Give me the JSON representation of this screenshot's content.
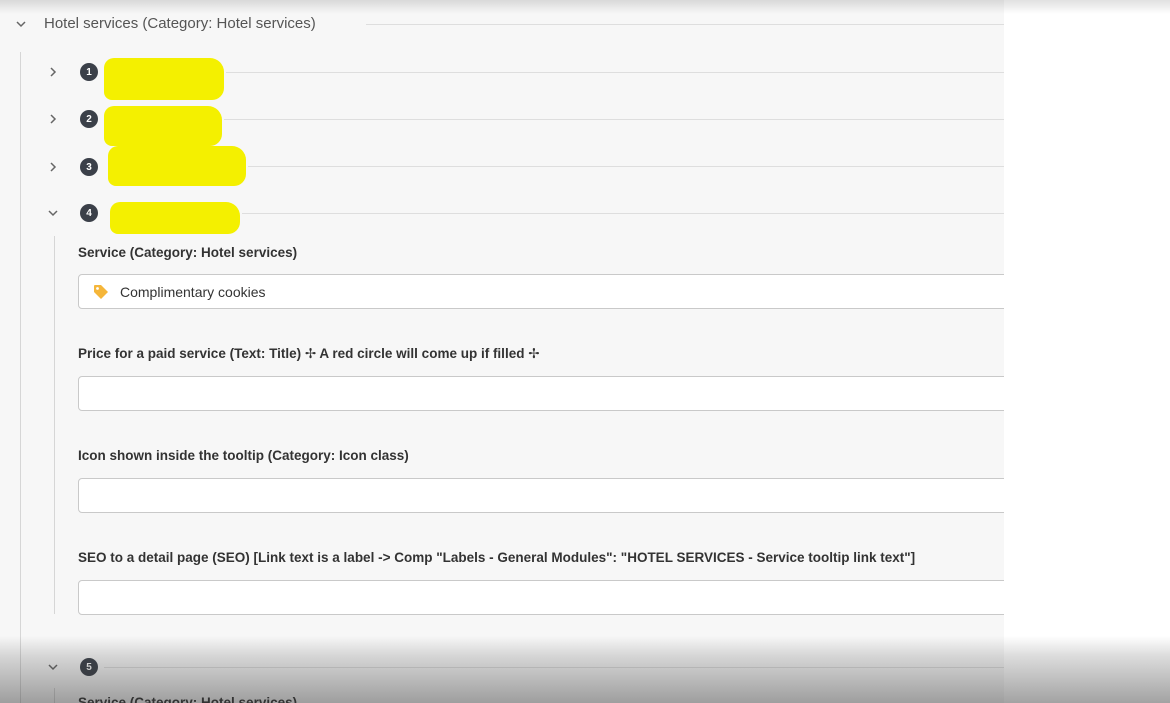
{
  "section": {
    "title": "Hotel services (Category: Hotel services)"
  },
  "items": [
    {
      "number": "1",
      "expanded": false
    },
    {
      "number": "2",
      "expanded": false
    },
    {
      "number": "3",
      "expanded": false
    },
    {
      "number": "4",
      "expanded": true
    },
    {
      "number": "5",
      "expanded": true
    }
  ],
  "item4": {
    "service_label": "Service (Category: Hotel services)",
    "service_value": "Complimentary cookies",
    "price_label": "Price for a paid service (Text: Title) ✢ A red circle will come up if filled ✢",
    "price_value": "",
    "icon_label": "Icon shown inside the tooltip (Category: Icon class)",
    "icon_value": "",
    "seo_label": "SEO to a detail page (SEO) [Link text is a label -> Comp \"Labels - General Modules\": \"HOTEL SERVICES - Service tooltip link text\"]",
    "seo_value": ""
  },
  "item5": {
    "service_label": "Service (Category: Hotel services)"
  },
  "colors": {
    "highlight": "#f4f000",
    "badge": "#3b4049",
    "tag_icon": "#f5b63a"
  },
  "icons": {
    "collapsed": "chevron-right-icon",
    "expanded": "chevron-down-icon",
    "tag": "tag-icon"
  }
}
